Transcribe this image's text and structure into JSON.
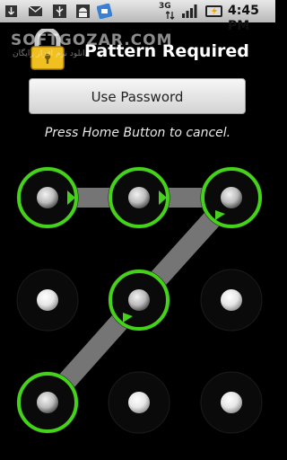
{
  "status_bar": {
    "network": "3G",
    "time": "4:45 PM",
    "icons": [
      "usb-icon",
      "mail-icon",
      "usb-debug-icon",
      "android-icon",
      "download-icon",
      "signal-icon",
      "battery-icon"
    ]
  },
  "header": {
    "watermark": "SOFTGOZAR.COM",
    "watermark_sub": "دانلود نرم افزار رایگان",
    "title": "Pattern Required",
    "lock_icon": "lock-icon"
  },
  "use_password_label": "Use Password",
  "hint": "Press Home Button to cancel.",
  "pattern": {
    "grid_size": 3,
    "selected_dots": [
      0,
      1,
      2,
      4,
      6
    ],
    "path_order": [
      0,
      1,
      2,
      4,
      6
    ],
    "ring_color": "#44d21a",
    "line_color": "#8a8a8a"
  }
}
